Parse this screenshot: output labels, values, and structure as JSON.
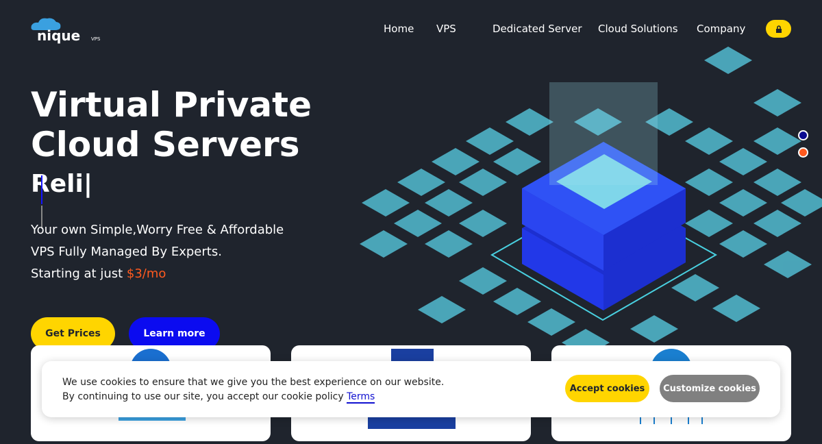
{
  "brand": {
    "logo_text": "nique",
    "logo_suffix": "VPS"
  },
  "nav": {
    "items": [
      "Home",
      "VPS",
      "Dedicated Server",
      "Cloud Solutions",
      "Company"
    ],
    "lock_icon": "lock-icon"
  },
  "hero": {
    "title": "Virtual Private Cloud Servers",
    "typed": "Reli|",
    "lines": [
      "Your own Simple,Worry Free & Affordable",
      "VPS Fully Managed By Experts."
    ],
    "starting": "Starting at just ",
    "price": "$3/mo",
    "get_prices": "Get Prices",
    "learn_more": "Learn more"
  },
  "colors": {
    "accent": "#ffd500",
    "primary": "#0b0bf0",
    "price": "#ff5a1f",
    "bg": "#1f242d"
  },
  "cookie": {
    "line1": "We use cookies to ensure that we give you the best experience on our website.",
    "line2": "By continuing to use our site, you accept our cookie policy ",
    "terms": "Terms",
    "accept": "Accept cookies",
    "customize": "Customize cookies"
  }
}
